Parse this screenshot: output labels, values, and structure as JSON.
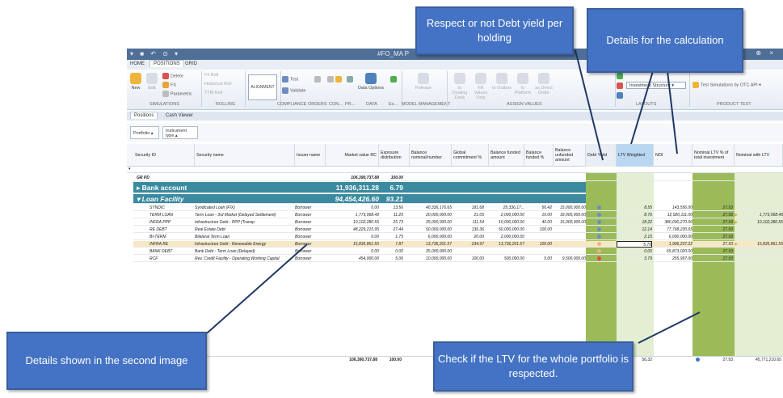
{
  "window": {
    "title": "#FO_MA    P",
    "quick_access": "▾ ■ ↶ ⊙ ▾",
    "controls": "⊕ ×"
  },
  "ribbon_tabs": [
    "HOME",
    "POSITIONS",
    "GRID"
  ],
  "ribbon": {
    "simulations": {
      "new": "New",
      "edit": "Edit",
      "delete": "Delete",
      "fx": "FX",
      "parametric": "Parametric",
      "group_label": "SIMULATIONS"
    },
    "rolling": {
      "fit_roll": "Fit Roll",
      "historical_roll": "Historical Roll",
      "ttm_roll": "TTM Roll",
      "group_label": "ROLLING"
    },
    "alignment": "ALIGNMENT",
    "compliance": {
      "test": "Test",
      "validate": "Validate",
      "group_label": "COMPLIANCE"
    },
    "orders_label": "ORDERS",
    "con_label": "CON...",
    "pr_label": "PR...",
    "data": {
      "options": "Data Options",
      "group_label": "DATA"
    },
    "ex_label": "Ex...",
    "model_management": {
      "release": "Release",
      "group_label": "MODEL MANAGEMENT"
    },
    "assign_values": {
      "to_dealing": "to Dealing Desk",
      "fill_values": "Fill Values Only",
      "to_outbox": "to Outbox",
      "to_platform": "to Platform",
      "as_direct_order": "as Direct Order",
      "group_label": "ASSIGN VALUES"
    },
    "layouts": {
      "dropdown": "Investment Structure",
      "group_label": "LAYOUTS"
    },
    "product_test": {
      "dropdown": "Test Simulations by OTC API",
      "group_label": "PRODUCT TEST"
    }
  },
  "doc_tabs": [
    "Positions",
    "Cash Viewer"
  ],
  "group_chips": [
    "Portfolio",
    "Instrument type"
  ],
  "columns": [
    "Security ID",
    "Security name",
    "Issuer name",
    "Market value RC",
    "Exposure distribution",
    "Balance nominal/number",
    "Global commitment %",
    "Balance funded amount",
    "Balance funded %",
    "Balance unfunded amount",
    "Debt Yield",
    "LTV Weighted",
    "NOI",
    "Nominal LTV % of total investment",
    "Nominal with LTV"
  ],
  "group_row": {
    "name": "GR PD",
    "market_value": "106,390,737.88",
    "exposure": "100.00"
  },
  "bank_account": {
    "name": "Bank account",
    "market_value": "11,936,311.28",
    "exposure": "6.79"
  },
  "loan_facility": {
    "name": "Loan Facility",
    "market_value": "94,454,426.60",
    "exposure": "93.21"
  },
  "rows": [
    {
      "id": "SYNDIC",
      "name": "Syndicated Loan (FIX)",
      "issuer": "Borrower",
      "mv": "0.00",
      "exp": "13.56",
      "bal": "40,336,176.65",
      "gc": "181.68",
      "bfa": "25,336,17...",
      "bfp": "56.42",
      "bua": "15,000,000.00",
      "dy": "blue",
      "ltvw": "8.55",
      "noi": "143,556.00",
      "nltv": "27.93",
      "nwl": ""
    },
    {
      "id": "TERM LOAN",
      "name": "Term Loan - 3rd Market (Delayed Settlement)",
      "issuer": "Borrower",
      "mv": "1,773,068.49",
      "exp": "11.25",
      "bal": "20,000,000.00",
      "gc": "21.05",
      "bfa": "2,000,000.00",
      "bfp": "10.00",
      "bua": "18,000,000.00",
      "dy": "blue",
      "ltvw": "8.76",
      "noi": "12,920,111.00",
      "nltv": "27.93",
      "nwl": "1,773,068.49"
    },
    {
      "id": "INFRA PPP",
      "name": "Infrastructure Debt - PPP (Transp.",
      "issuer": "Borrower",
      "mv": "10,102,280.55",
      "exp": "25.73",
      "bal": "25,000,000.00",
      "gc": "111.54",
      "bfa": "10,000,000.00",
      "bfp": "40.00",
      "bua": "15,000,000.00",
      "dy": "blue",
      "ltvw": "18.22",
      "noi": "380,000,270.00",
      "nltv": "27.93",
      "nwl": "10,102,280.55"
    },
    {
      "id": "RE DEBT",
      "name": "Real Estate Debt",
      "issuer": "Borrower",
      "mv": "48,229,215.95",
      "exp": "27.44",
      "bal": "50,000,000.00",
      "gc": "136.36",
      "bfa": "50,000,000.00",
      "bfp": "100.00",
      "bua": "",
      "dy": "blue",
      "ltvw": "12.14",
      "noi": "77,768,230.65",
      "nltv": "27.93",
      "nwl": ""
    },
    {
      "id": "BI-TERM",
      "name": "Bilateral Term Loan",
      "issuer": "Borrower",
      "mv": "0.00",
      "exp": "1.75",
      "bal": "6,000,000.00",
      "gc": "20.00",
      "bfa": "2,000,000.00",
      "bfp": "",
      "bua": "",
      "dy": "blue",
      "ltvw": "2.15",
      "noi": "6,000,000.00",
      "nltv": "27.93",
      "nwl": ""
    },
    {
      "id": "INFRA RE",
      "name": "Infrastructure Debt - Renewable Energy",
      "issuer": "Borrower",
      "mv": "15,835,861.55",
      "exp": "7.87",
      "bal": "13,736,201.57",
      "gc": "234.97",
      "bfa": "13,736,201.57",
      "bfp": "100.00",
      "bua": "",
      "dy": "orange",
      "ltvw": "5.70",
      "noi": "1,996,237.22",
      "nltv": "27.93",
      "nwl": "15,835,861.55"
    },
    {
      "id": "BANK DEBT",
      "name": "Bank Debt - Term Loan (Delayed)",
      "issuer": "Borrower",
      "mv": "0.00",
      "exp": "0.00",
      "bal": "25,000,000.00",
      "gc": "",
      "bfa": "",
      "bfp": "",
      "bua": "",
      "dy": "orange",
      "ltvw": "0.00",
      "noi": "65,873,020.00",
      "nltv": "27.93",
      "nwl": ""
    },
    {
      "id": "RCF",
      "name": "Rev. Credit Facility - Operating Working Capital",
      "issuer": "Borrower",
      "mv": "454,000.00",
      "exp": "5.06",
      "bal": "10,000,000.00",
      "gc": "100.00",
      "bfa": "500,000.00",
      "bfp": "5.00",
      "bua": "9,500,000.00",
      "dy": "red",
      "ltvw": "3.79",
      "noi": "255,997.00",
      "nltv": "27.93",
      "nwl": ""
    }
  ],
  "totals": {
    "mv": "106,390,737.88",
    "exp": "100.00",
    "ltvw": "56.32",
    "nltv": "27.93",
    "nwl": "45,771,210.65"
  },
  "callouts": {
    "debt_yield": "Respect or not Debt yield per holding",
    "details_calc": "Details for the calculation",
    "second_image": "Details shown in the second image",
    "ltv_check": "Check if the LTV for the whole portfolio is respected."
  },
  "colors": {
    "callout": "#4472c4",
    "group_row": "#3a8aa0",
    "green_col": "#9bbb59",
    "light_green": "#e4eed2",
    "selected": "#f6e8c4"
  }
}
